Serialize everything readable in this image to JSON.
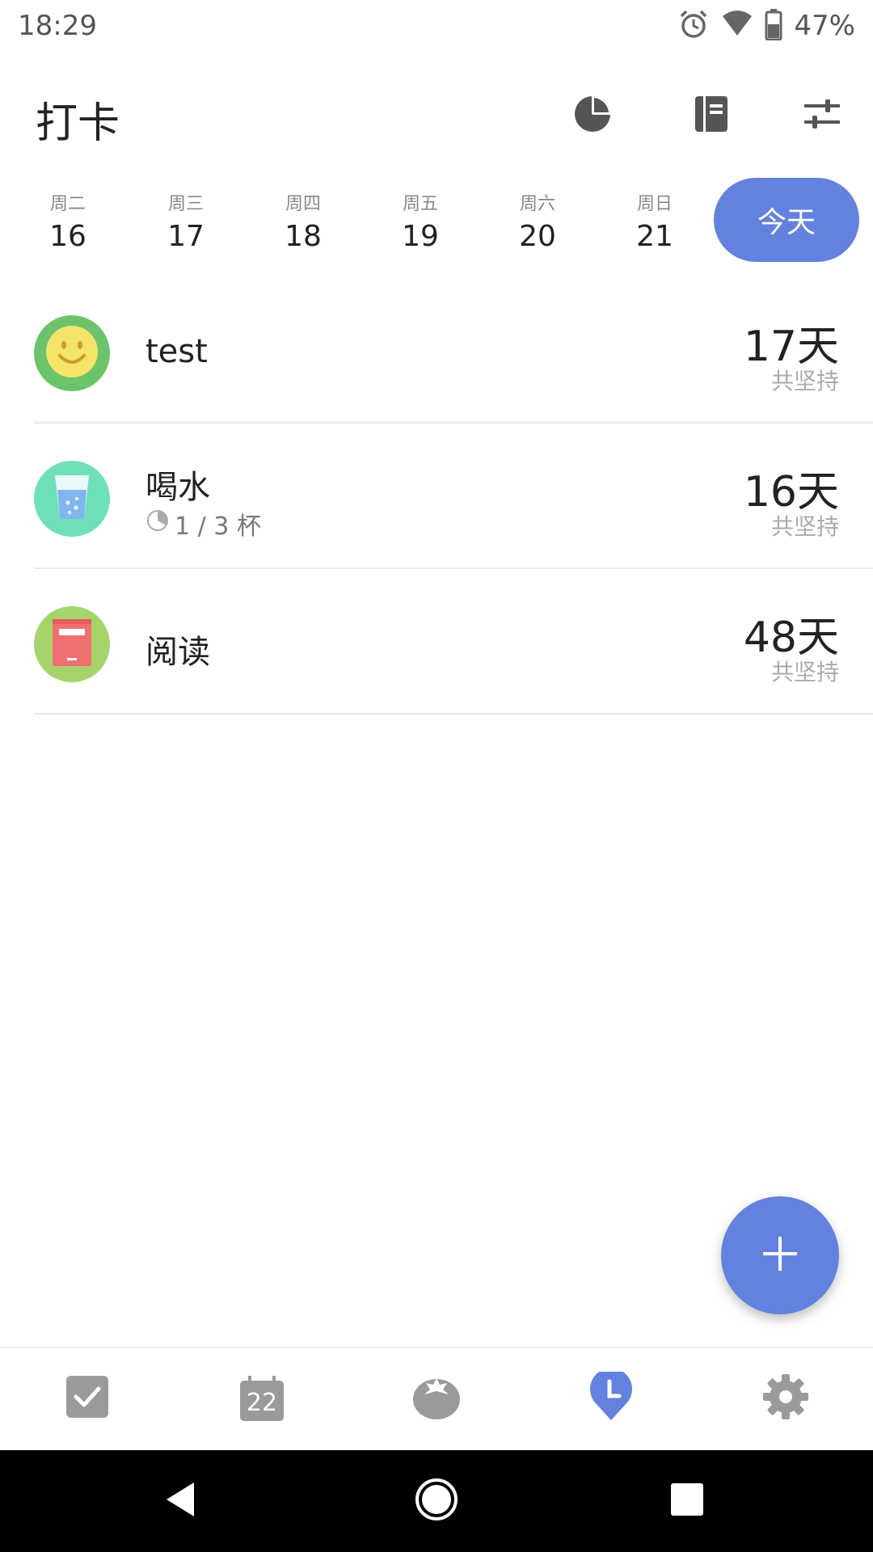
{
  "status_bar": {
    "time": "18:29",
    "battery_percent": "47%",
    "icons": [
      "alarm-icon",
      "wifi-icon",
      "battery-icon"
    ]
  },
  "header": {
    "title": "打卡",
    "actions": [
      "pie-chart-icon",
      "notebook-icon",
      "sliders-icon"
    ]
  },
  "date_strip": {
    "days": [
      {
        "weekday": "周二",
        "date": "16"
      },
      {
        "weekday": "周三",
        "date": "17"
      },
      {
        "weekday": "周四",
        "date": "18"
      },
      {
        "weekday": "周五",
        "date": "19"
      },
      {
        "weekday": "周六",
        "date": "20"
      },
      {
        "weekday": "周日",
        "date": "21"
      }
    ],
    "today_label": "今天"
  },
  "habits": [
    {
      "name": "test",
      "icon": "smiley-icon",
      "count": "17天",
      "label": "共坚持",
      "progress": null
    },
    {
      "name": "喝水",
      "icon": "water-glass-icon",
      "count": "16天",
      "label": "共坚持",
      "progress": "1 / 3 杯"
    },
    {
      "name": "阅读",
      "icon": "book-icon",
      "count": "48天",
      "label": "共坚持",
      "progress": null
    }
  ],
  "bottom_nav": {
    "items": [
      "checkbox-icon",
      "calendar-icon",
      "tomato-icon",
      "clock-pin-icon",
      "gear-icon"
    ],
    "calendar_day": "22",
    "active_index": 3
  },
  "colors": {
    "accent": "#6382e0",
    "test_avatar_bg": "#6cc36c",
    "water_avatar_bg": "#6ee0b8",
    "read_avatar_bg": "#a6d46a"
  }
}
